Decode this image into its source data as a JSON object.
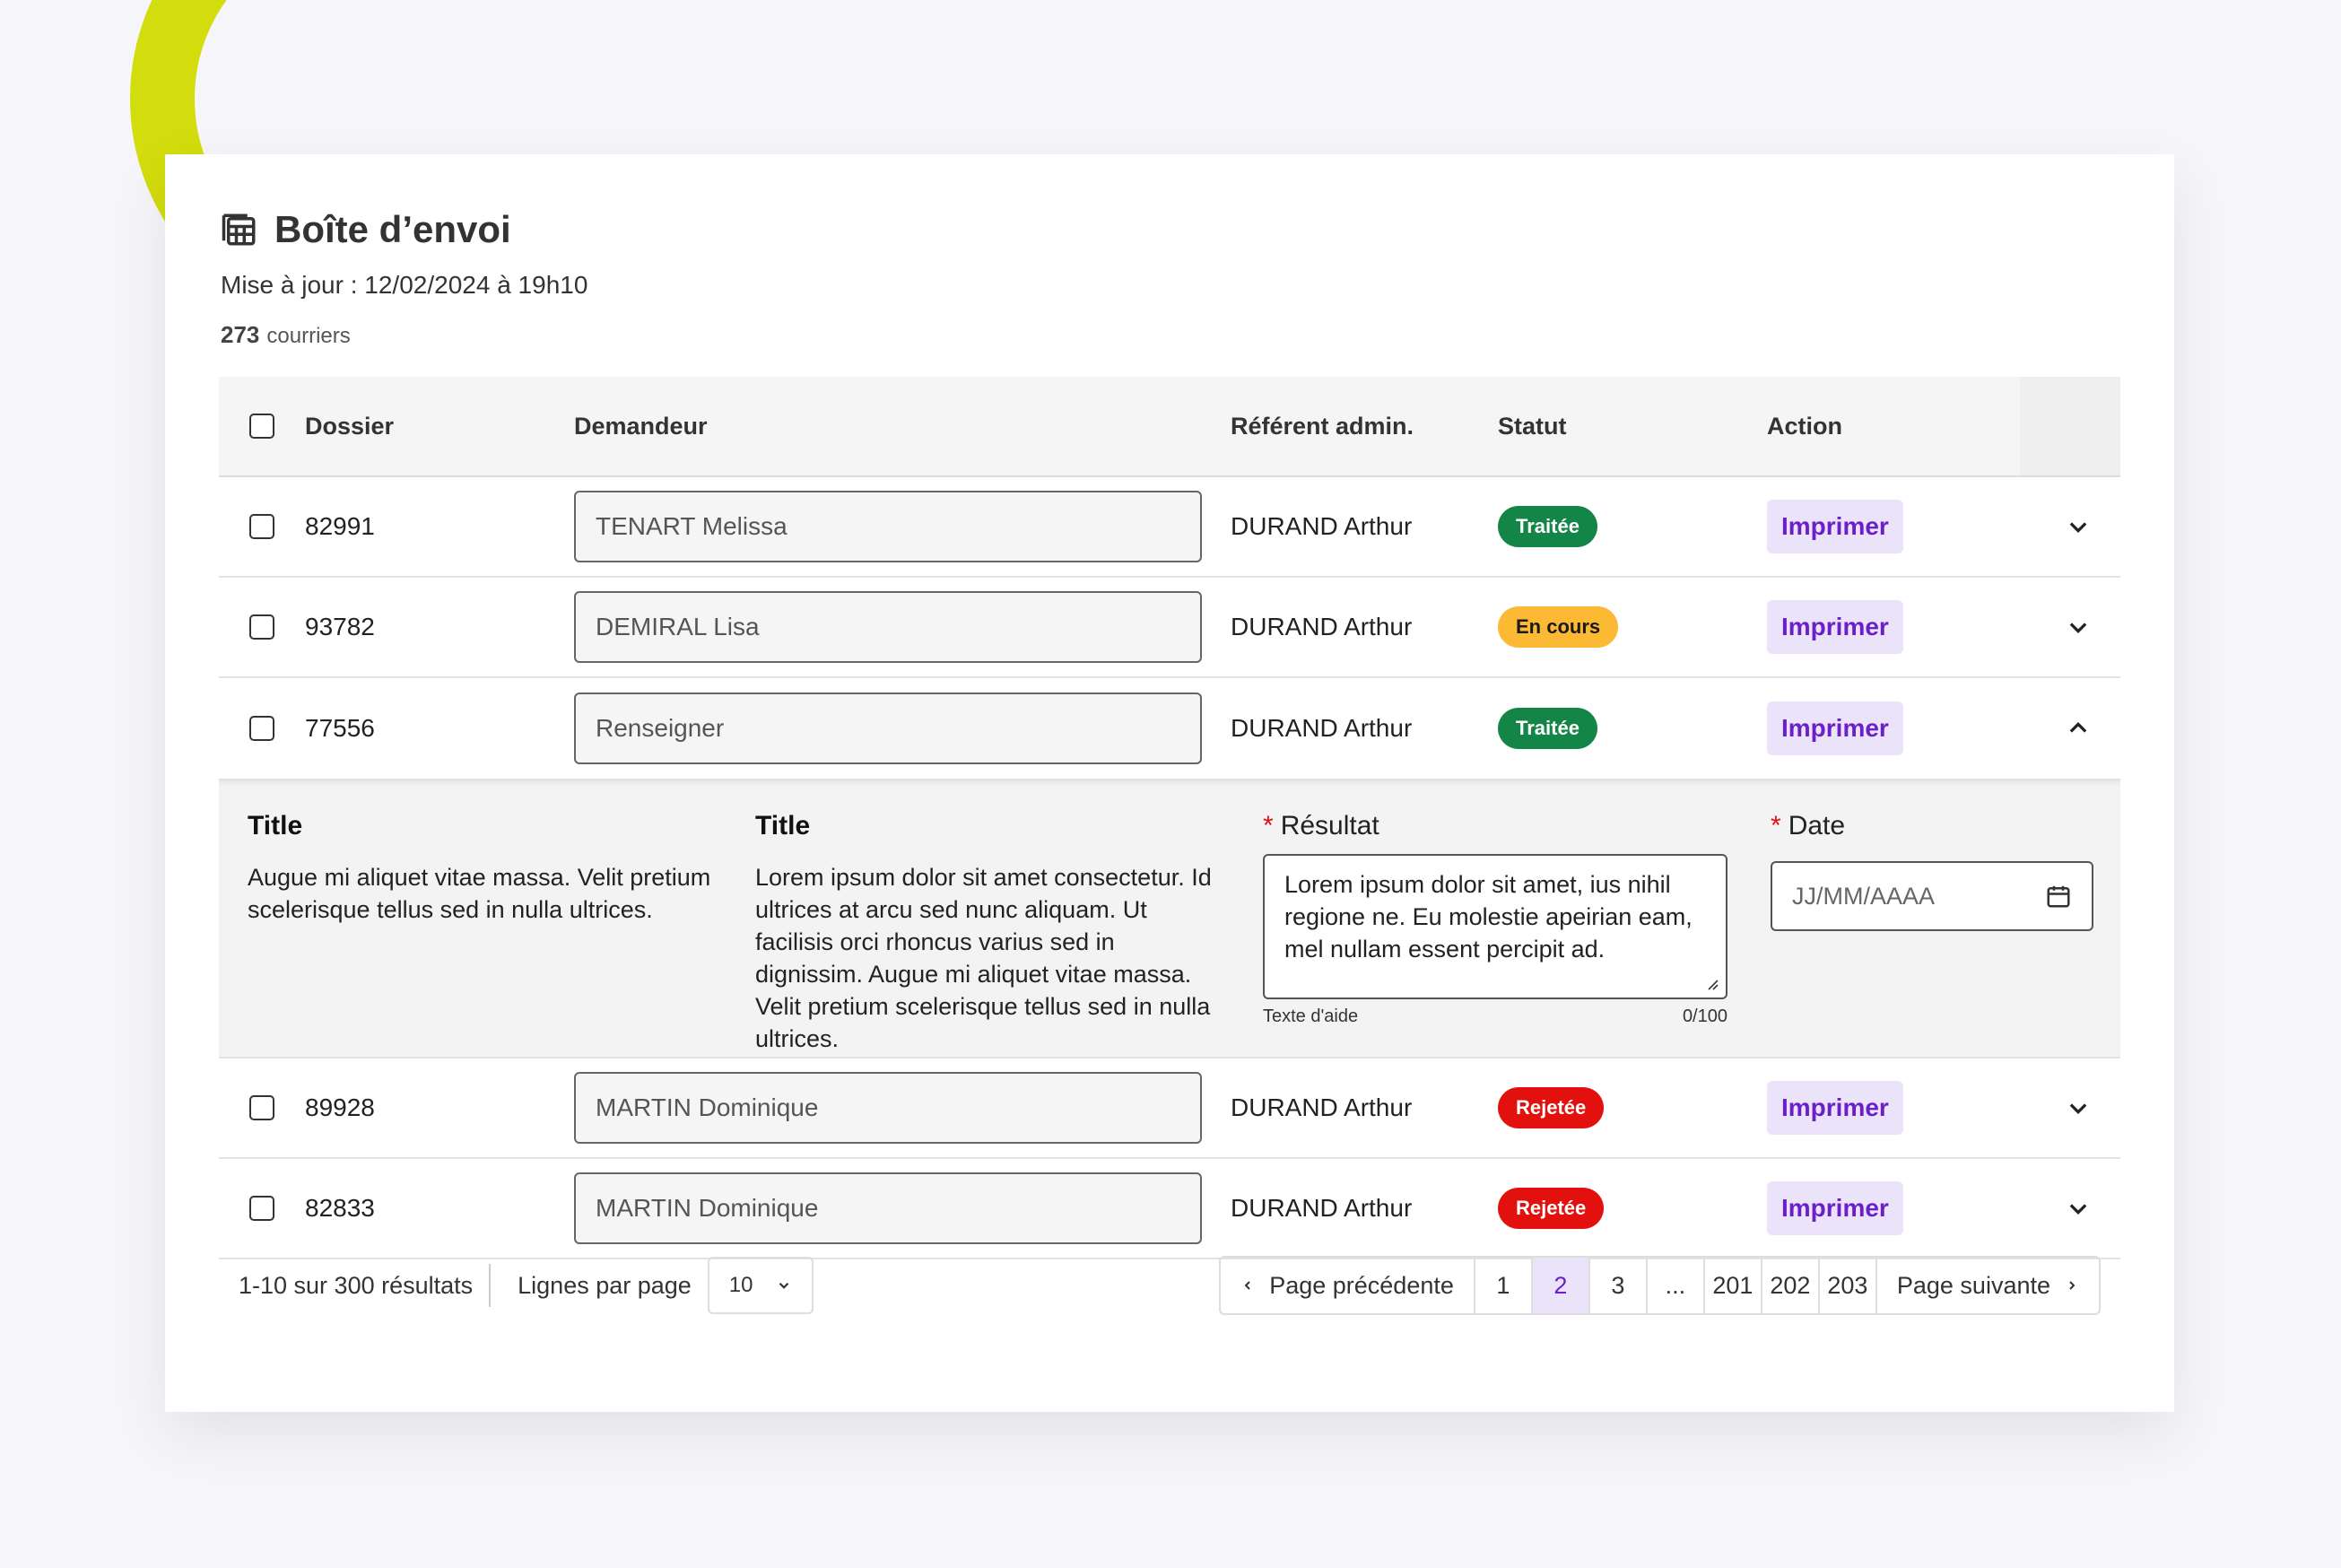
{
  "header": {
    "title": "Boîte d’envoi",
    "updated": "Mise à jour : 12/02/2024 à 19h10",
    "count_number": "273",
    "count_label": "courriers"
  },
  "table": {
    "columns": [
      "Dossier",
      "Demandeur",
      "Référent admin.",
      "Statut",
      "Action"
    ],
    "rows": [
      {
        "dossier": "82991",
        "demandeur": "TENART Melissa",
        "referent": "DURAND Arthur",
        "statut": "Traitée",
        "action": "Imprimer"
      },
      {
        "dossier": "93782",
        "demandeur": "DEMIRAL Lisa",
        "referent": "DURAND Arthur",
        "statut": "En cours",
        "action": "Imprimer"
      },
      {
        "dossier": "77556",
        "demandeur": "Renseigner",
        "referent": "DURAND Arthur",
        "statut": "Traitée",
        "action": "Imprimer"
      },
      {
        "dossier": "89928",
        "demandeur": "MARTIN Dominique",
        "referent": "DURAND Arthur",
        "statut": "Rejetée",
        "action": "Imprimer"
      },
      {
        "dossier": "82833",
        "demandeur": "MARTIN Dominique",
        "referent": "DURAND Arthur",
        "statut": "Rejetée",
        "action": "Imprimer"
      }
    ]
  },
  "expanded": {
    "col1_title": "Title",
    "col1_text": "Augue mi aliquet vitae massa. Velit pretium scelerisque tellus sed in nulla ultrices.",
    "col2_title": "Title",
    "col2_text": "Lorem ipsum dolor sit amet consectetur. Id ultrices at arcu sed nunc aliquam. Ut facilisis orci rhoncus varius sed in dignissim. Augue mi aliquet vitae massa. Velit pretium scelerisque tellus sed in nulla ultrices.",
    "result_label": "Résultat",
    "result_value": "Lorem ipsum dolor sit amet, ius nihil regione ne. Eu molestie apeirian eam, mel nullam essent percipit ad.",
    "helper_text": "Texte d'aide",
    "char_count": "0/100",
    "date_label": "Date",
    "date_placeholder": "JJ/MM/AAAA",
    "required_mark": "*"
  },
  "footer": {
    "results": "1-10 sur 300 résultats",
    "lines_per_page": "Lignes par page",
    "lines_value": "10",
    "prev": "Page précédente",
    "next": "Page suivante",
    "pages": [
      "1",
      "2",
      "3",
      "...",
      "201",
      "202",
      "203"
    ]
  },
  "colors": {
    "accent": "#6a1fc9",
    "accent_bg": "#ebe3fa",
    "green": "#138546",
    "yellow": "#fbb934",
    "red": "#e2110e",
    "lime": "#d3dc0c"
  }
}
